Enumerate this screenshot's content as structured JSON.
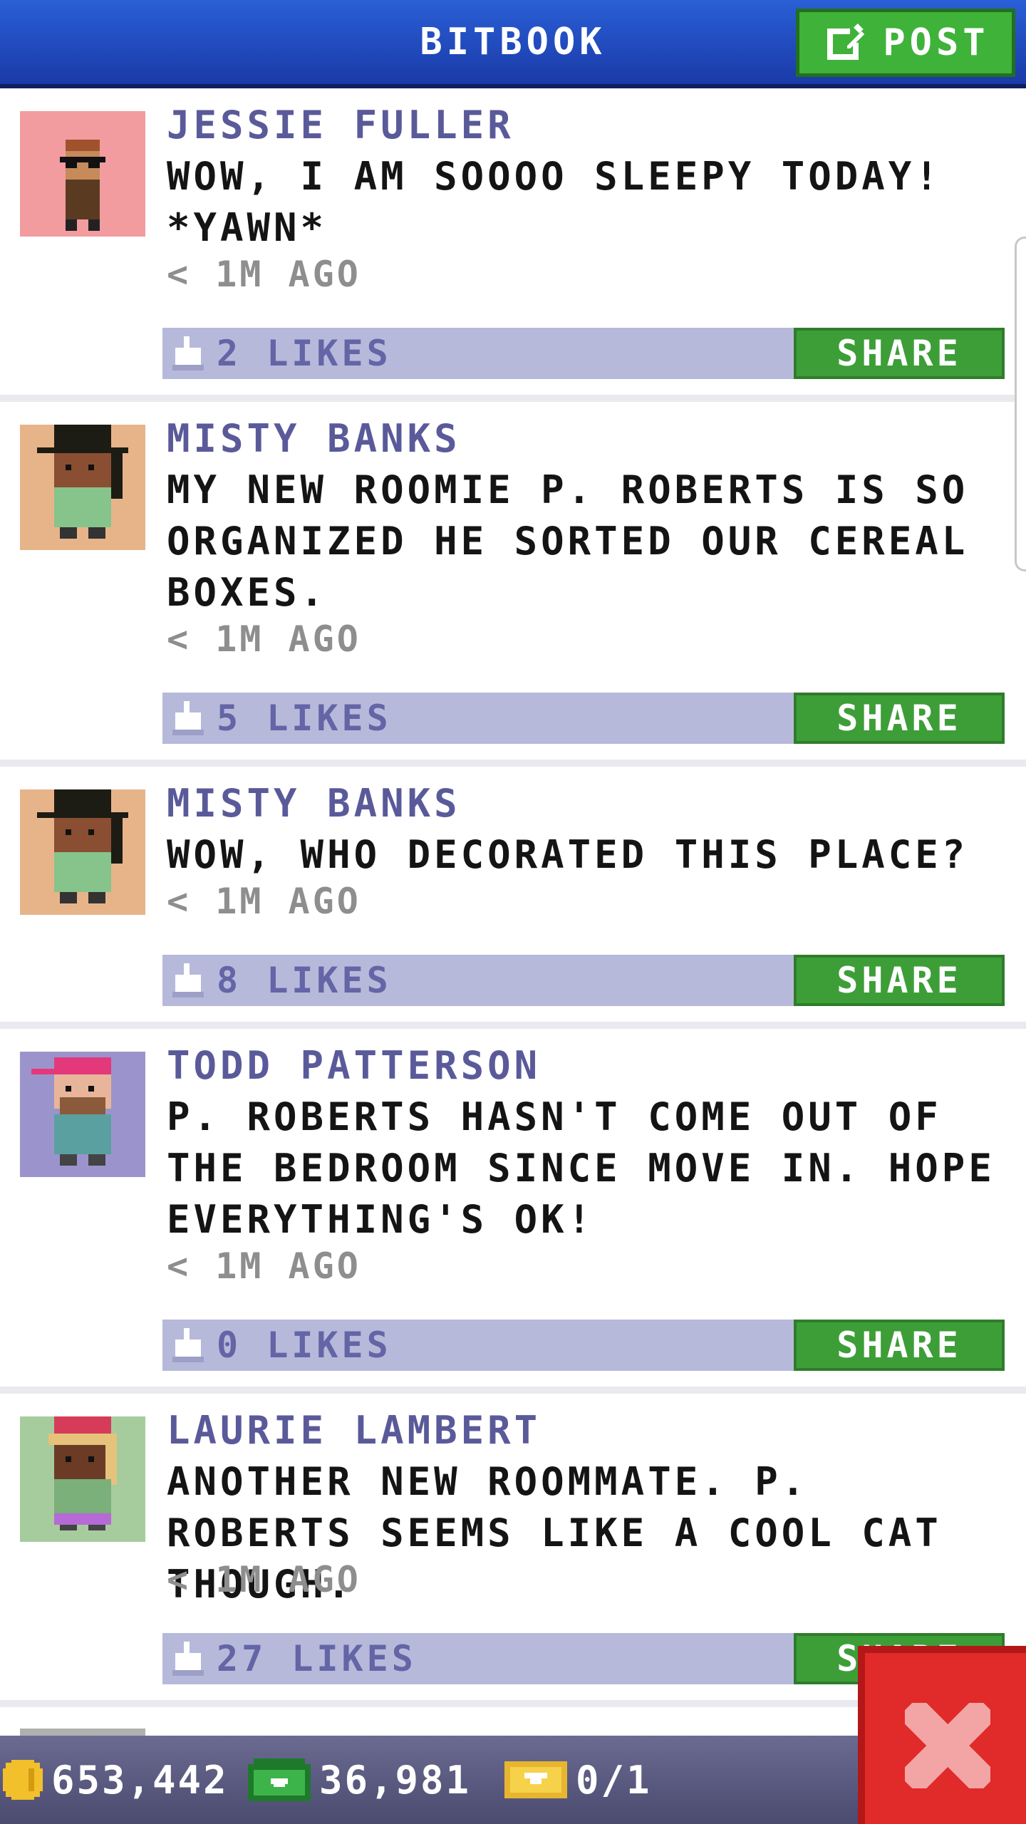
{
  "header": {
    "title": "BITBOOK",
    "post_label": "POST"
  },
  "posts": [
    {
      "author": "JESSIE FULLER",
      "message": "WOW, I AM SOOOO SLEEPY TODAY! *YAWN*",
      "time": "< 1M AGO",
      "likes": "2 LIKES",
      "share_label": "SHARE",
      "avatar_bg": "#f29ca0"
    },
    {
      "author": "MISTY BANKS",
      "message": "MY NEW ROOMIE P. ROBERTS IS SO ORGANIZED HE SORTED OUR CEREAL BOXES.",
      "time": "< 1M AGO",
      "likes": "5 LIKES",
      "share_label": "SHARE",
      "avatar_bg": "#e7b48a"
    },
    {
      "author": "MISTY BANKS",
      "message": "WOW, WHO DECORATED THIS PLACE?",
      "time": "< 1M AGO",
      "likes": "8 LIKES",
      "share_label": "SHARE",
      "avatar_bg": "#e7b48a"
    },
    {
      "author": "TODD PATTERSON",
      "message": "P. ROBERTS HASN'T COME OUT OF THE BEDROOM SINCE MOVE IN. HOPE EVERYTHING'S OK!",
      "time": "< 1M AGO",
      "likes": "0 LIKES",
      "share_label": "SHARE",
      "avatar_bg": "#9b94cc"
    },
    {
      "author": "LAURIE LAMBERT",
      "message": "ANOTHER NEW ROOMMATE. P. ROBERTS SEEMS LIKE A COOL CAT THOUGH.",
      "time": "< 1M AGO",
      "likes": "27 LIKES",
      "share_label": "SHARE",
      "avatar_bg": "#a6cc9e"
    }
  ],
  "status": {
    "coins": "653,442",
    "bux": "36,981",
    "tickets": "0/1"
  },
  "colors": {
    "header": "#1a3aa8",
    "post_green": "#3fb23a",
    "likes_bar": "#b7b9da",
    "author": "#5a5a9a",
    "close_red": "#e12a2a"
  },
  "icons": [
    "edit-icon",
    "like-icon",
    "coin-icon",
    "bux-icon",
    "ticket-icon",
    "close-icon"
  ]
}
